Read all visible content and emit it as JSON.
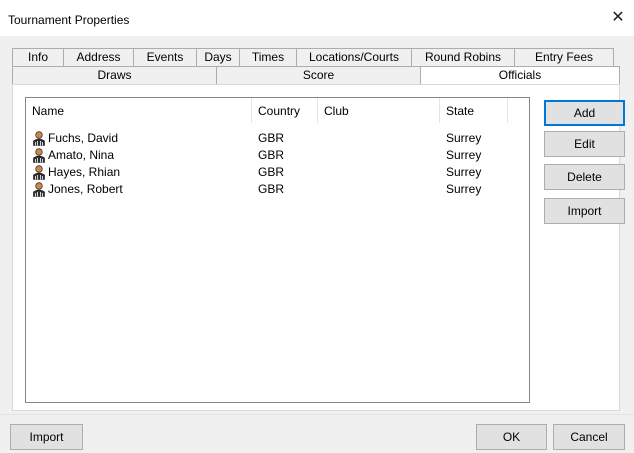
{
  "window": {
    "title": "Tournament Properties",
    "close_glyph": "✕"
  },
  "tabs": {
    "row1": [
      "Info",
      "Address",
      "Events",
      "Days",
      "Times",
      "Locations/Courts",
      "Round Robins",
      "Entry Fees"
    ],
    "row2": [
      "Draws",
      "Score",
      "Officials"
    ],
    "active": "Officials"
  },
  "officials": {
    "columns": [
      "Name",
      "Country",
      "Club",
      "State"
    ],
    "rows": [
      {
        "name": "Fuchs, David",
        "country": "GBR",
        "club": "",
        "state": "Surrey",
        "icon": "person-icon"
      },
      {
        "name": "Amato, Nina",
        "country": "GBR",
        "club": "",
        "state": "Surrey",
        "icon": "person-icon"
      },
      {
        "name": "Hayes, Rhian",
        "country": "GBR",
        "club": "",
        "state": "Surrey",
        "icon": "person-icon"
      },
      {
        "name": "Jones, Robert",
        "country": "GBR",
        "club": "",
        "state": "Surrey",
        "icon": "person-icon"
      }
    ]
  },
  "side_buttons": {
    "add": "Add",
    "edit": "Edit",
    "delete": "Delete",
    "import": "Import"
  },
  "footer": {
    "import": "Import",
    "ok": "OK",
    "cancel": "Cancel"
  },
  "colors": {
    "accent": "#0078d7",
    "tab_border": "#adadad",
    "button_face": "#e1e1e1"
  }
}
